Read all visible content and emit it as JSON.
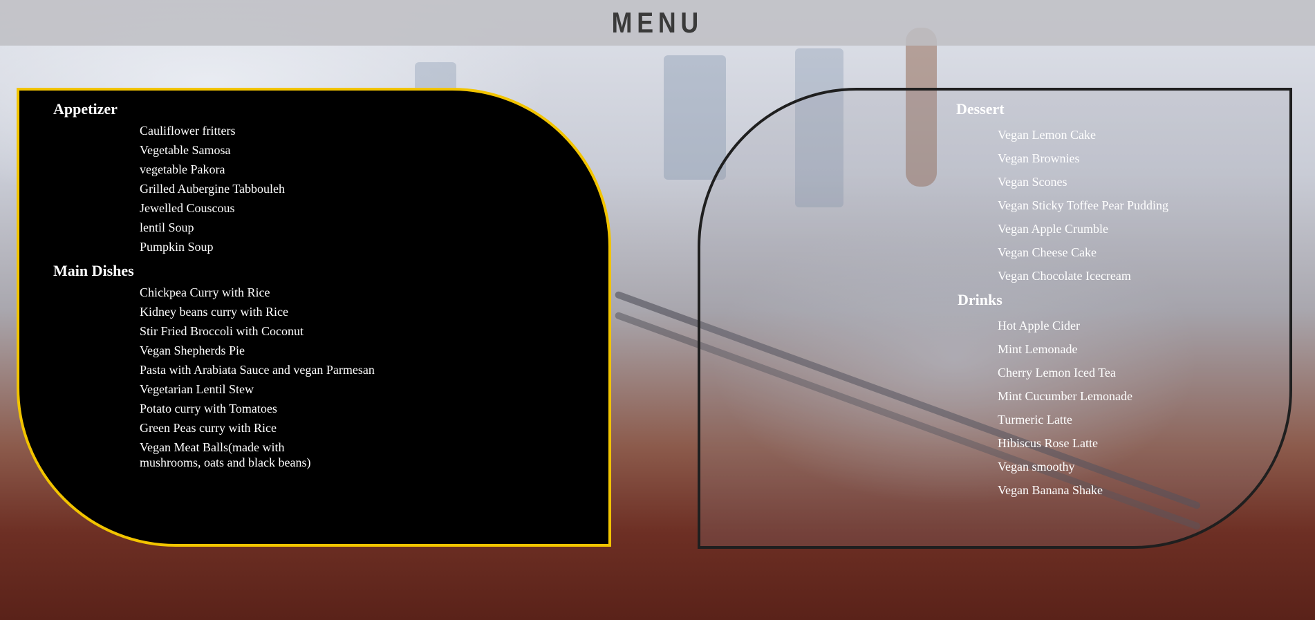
{
  "header": {
    "title": "MENU"
  },
  "left": {
    "appetizer_title": "Appetizer",
    "appetizer_items": [
      "Cauliflower fritters",
      "Vegetable Samosa",
      "vegetable Pakora",
      "Grilled Aubergine Tabbouleh",
      "Jewelled Couscous",
      "lentil Soup",
      "Pumpkin Soup"
    ],
    "main_title": "Main Dishes",
    "main_items": [
      "Chickpea Curry with Rice",
      "Kidney beans curry with Rice",
      "Stir Fried Broccoli with Coconut",
      "Vegan Shepherds Pie",
      "Pasta with Arabiata Sauce and vegan Parmesan",
      "Vegetarian Lentil Stew",
      "Potato curry with Tomatoes",
      "Green Peas curry with Rice",
      "Vegan Meat Balls(made with",
      "mushrooms, oats and black beans)"
    ]
  },
  "right": {
    "dessert_title": "Dessert",
    "dessert_items": [
      "Vegan Lemon Cake",
      "Vegan Brownies",
      "Vegan Scones",
      "Vegan Sticky Toffee Pear Pudding",
      "Vegan Apple Crumble",
      "Vegan Cheese Cake",
      "Vegan Chocolate Icecream"
    ],
    "drinks_title": "Drinks",
    "drinks_items": [
      "Hot Apple Cider",
      "Mint Lemonade",
      "Cherry Lemon Iced Tea",
      "Mint Cucumber Lemonade",
      "Turmeric Latte",
      "Hibiscus Rose Latte",
      "Vegan smoothy",
      "Vegan Banana Shake"
    ]
  },
  "colors": {
    "left_border": "#f2c400",
    "right_border": "#1f1f1f"
  }
}
